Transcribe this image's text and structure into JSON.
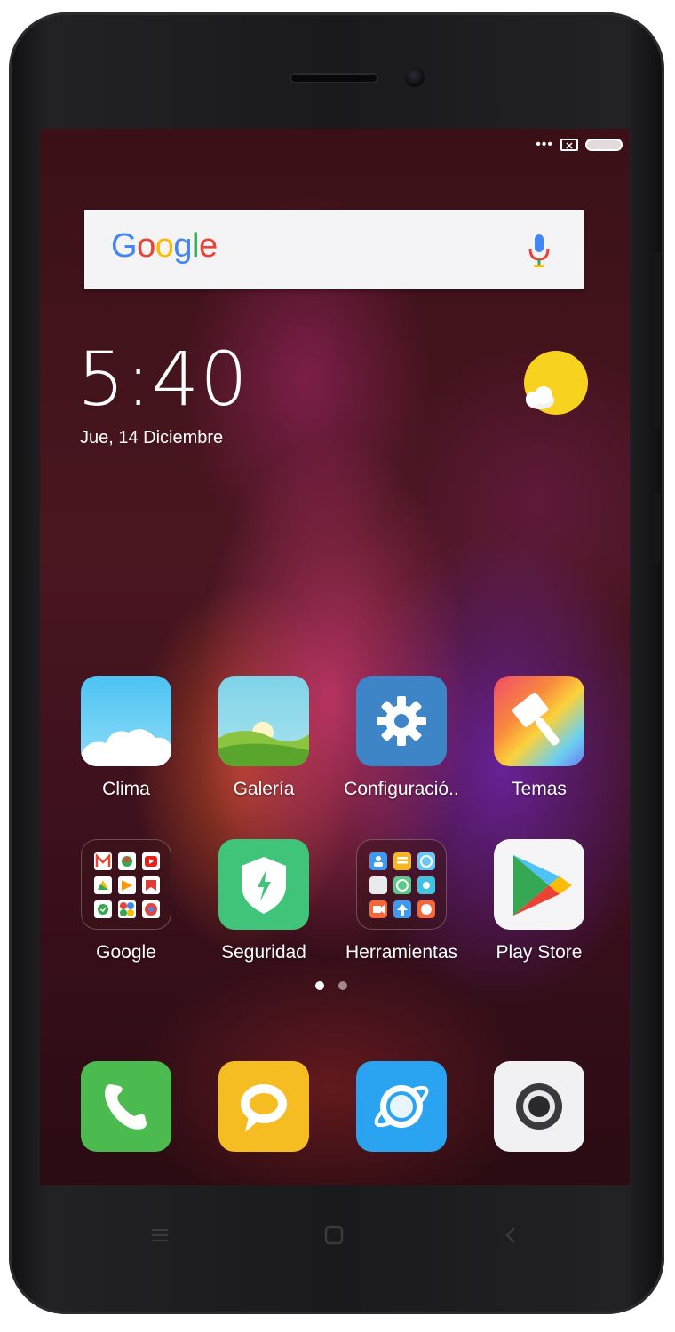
{
  "status_bar": {
    "dots_icon": "more-dots-icon",
    "notification_icon": "sim-x-icon",
    "battery_icon": "battery-icon"
  },
  "search_widget": {
    "logo": [
      "G",
      "o",
      "o",
      "g",
      "l",
      "e"
    ],
    "logo_colors": [
      "#4285F4",
      "#EA4335",
      "#FBBC05",
      "#4285F4",
      "#34A853",
      "#EA4335"
    ],
    "mic_icon": "microphone-icon"
  },
  "clock_widget": {
    "time": "5:40",
    "date": "Jue, 14 Diciembre",
    "weather_icon": "sun-cloud-icon"
  },
  "apps": [
    {
      "label": "Clima",
      "icon": "weather-icon"
    },
    {
      "label": "Galería",
      "icon": "gallery-icon"
    },
    {
      "label": "Configuració..",
      "icon": "settings-gear-icon"
    },
    {
      "label": "Temas",
      "icon": "themes-brush-icon"
    },
    {
      "label": "Google",
      "icon": "google-folder-icon"
    },
    {
      "label": "Seguridad",
      "icon": "security-shield-icon"
    },
    {
      "label": "Herramientas",
      "icon": "tools-folder-icon"
    },
    {
      "label": "Play Store",
      "icon": "play-store-icon"
    }
  ],
  "pager": {
    "pages": 2,
    "active": 0
  },
  "dock": [
    {
      "icon": "phone-icon"
    },
    {
      "icon": "messages-icon"
    },
    {
      "icon": "browser-icon"
    },
    {
      "icon": "camera-icon"
    }
  ],
  "nav_buttons": [
    "menu-icon",
    "home-icon",
    "back-icon"
  ],
  "colors": {
    "wallpaper_base": "#3a1016",
    "bezel": "#1a1a1d",
    "search_bg": "#f4f4f6",
    "weather_sun": "#f7d21e"
  }
}
